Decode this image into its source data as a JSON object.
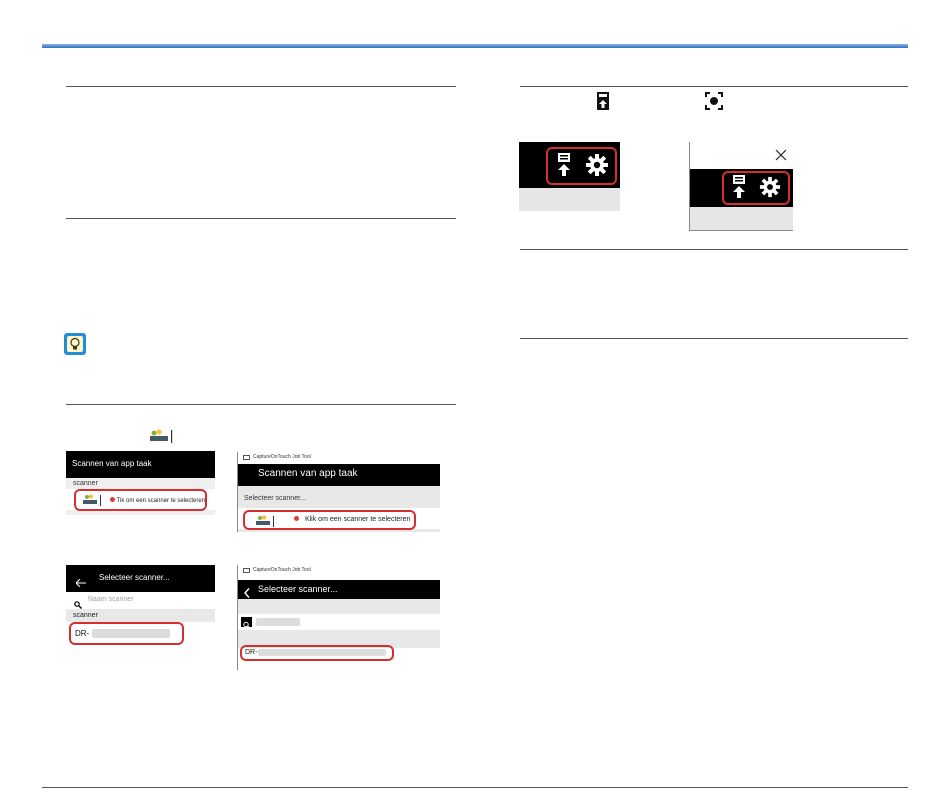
{
  "ss_android_task": {
    "header": "Scannen van app taak",
    "section": "scanner",
    "tap_label": "Tik om een scanner te selecteren"
  },
  "ss_win_task": {
    "app_title": "CaptureOnTouch Job Tool",
    "header": "Scannen van app taak",
    "section": "Selecteer scanner...",
    "click_label": "Klik om een scanner te selecteren"
  },
  "ss_android_select": {
    "header": "Selecteer scanner...",
    "search_placeholder": "Naam scanner",
    "section": "scanner",
    "item": "DR-"
  },
  "ss_win_select": {
    "app_title": "CaptureOnTouch Job Tool",
    "header": "Selecteer scanner...",
    "item": "DR-"
  },
  "colors": {
    "highlight": "#d32f2f",
    "accent_bar": "#2f6fc4"
  }
}
